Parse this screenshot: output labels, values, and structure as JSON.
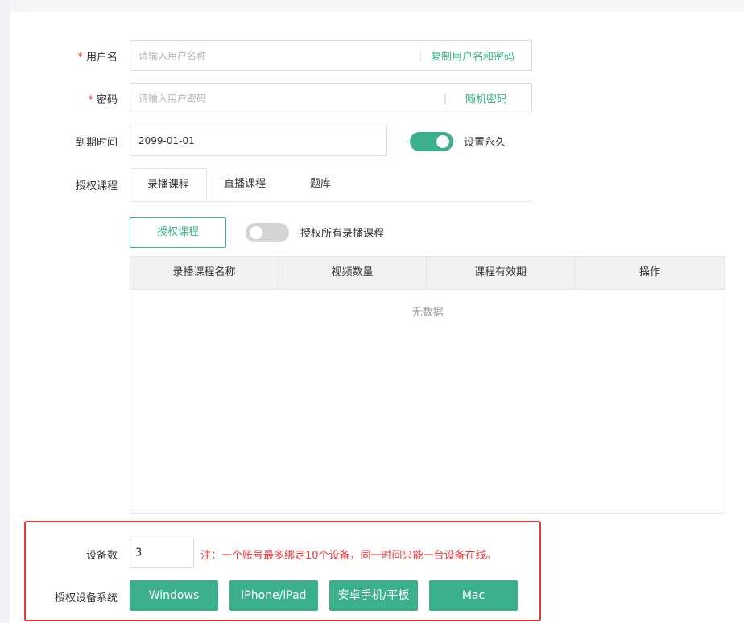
{
  "form": {
    "username": {
      "required_mark": "*",
      "label": "用户名",
      "placeholder": "请输入用户名称",
      "separator": "|",
      "action": "复制用户名和密码"
    },
    "password": {
      "required_mark": "*",
      "label": "密码",
      "placeholder": "请输入用户密码",
      "separator": "|",
      "action": "随机密码"
    },
    "expiry": {
      "label": "到期时间",
      "value": "2099-01-01",
      "permanent_toggle": {
        "on": true,
        "label": "设置永久"
      }
    },
    "authorize": {
      "label": "授权课程",
      "tabs": [
        {
          "label": "录播课程",
          "active": true
        },
        {
          "label": "直播课程",
          "active": false
        },
        {
          "label": "题库",
          "active": false
        }
      ],
      "authorize_button": "授权课程",
      "all_toggle": {
        "on": false,
        "label": "授权所有录播课程"
      },
      "table": {
        "columns": [
          "录播课程名称",
          "视频数量",
          "课程有效期",
          "操作"
        ],
        "empty_text": "无数据"
      }
    },
    "devices": {
      "label": "设备数",
      "value": "3",
      "note": "注：一个账号最多绑定10个设备，同一时间只能一台设备在线。"
    },
    "systems": {
      "label": "授权设备系统",
      "options": [
        "Windows",
        "iPhone/iPad",
        "安卓手机/平板",
        "Mac"
      ]
    }
  },
  "colors": {
    "accent": "#3caf8c",
    "danger": "#e4393c"
  }
}
